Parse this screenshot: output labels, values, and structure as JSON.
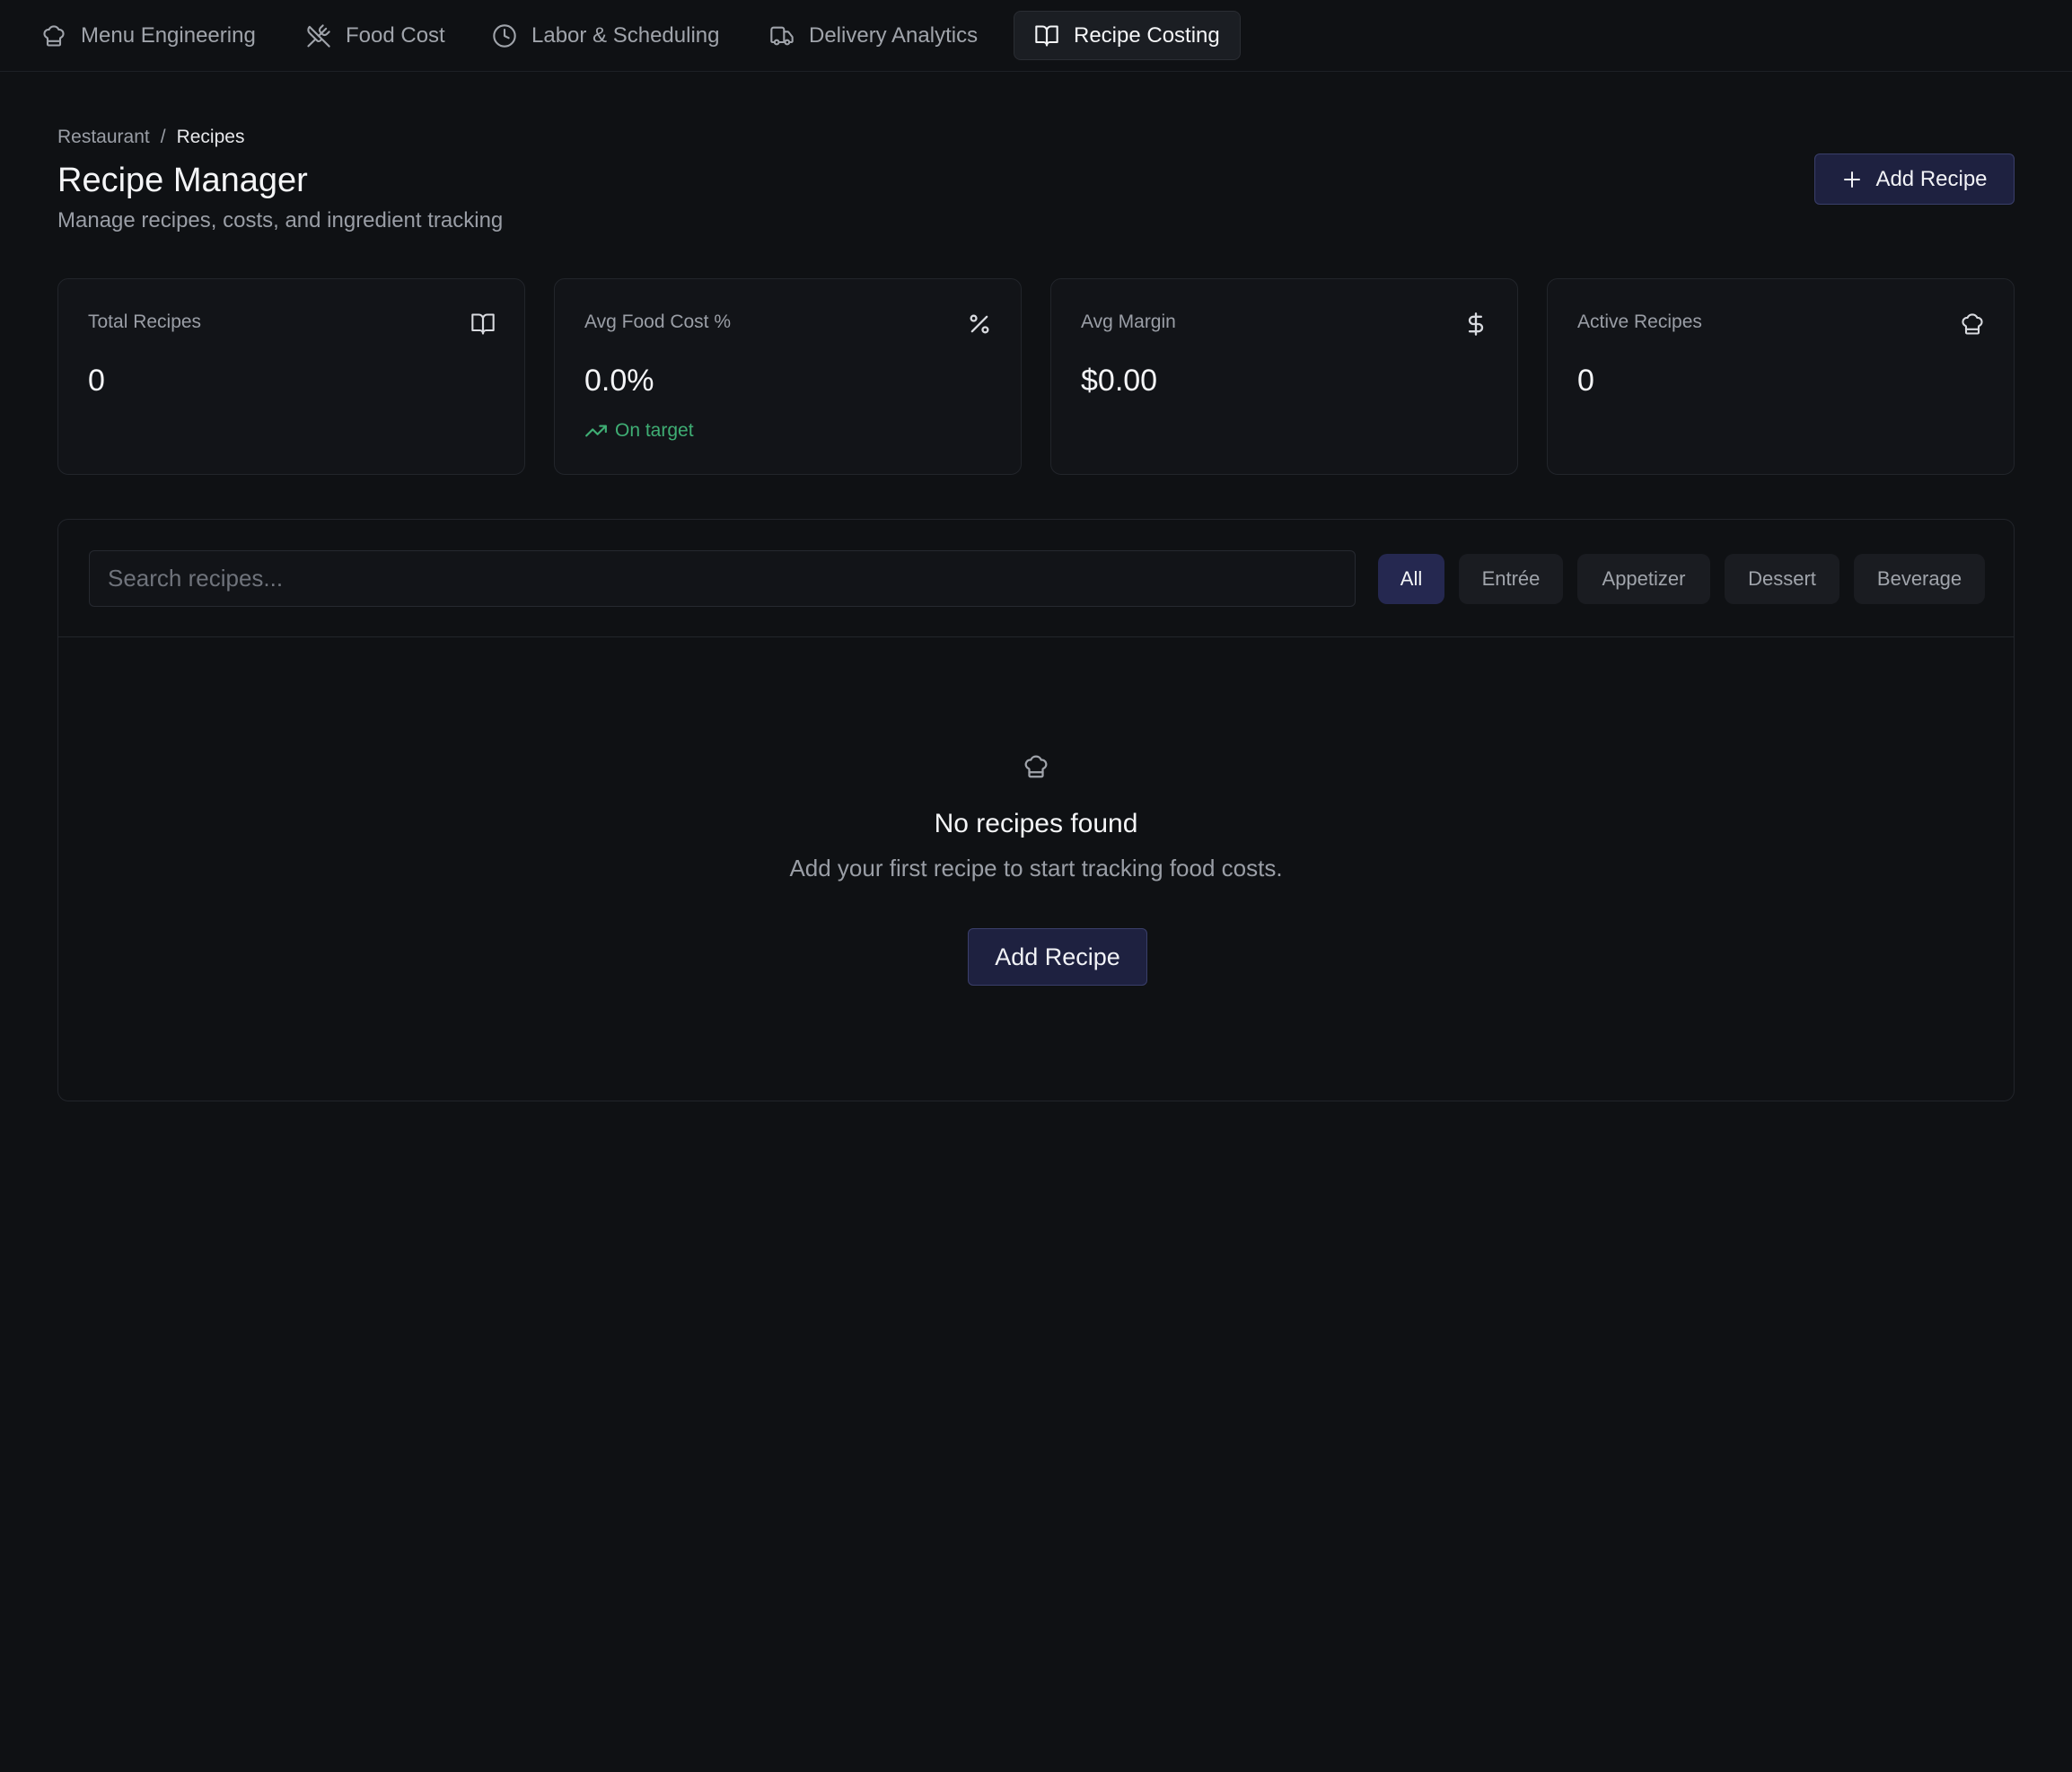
{
  "nav": {
    "tabs": [
      {
        "label": "Menu Engineering",
        "icon": "chef-hat-icon"
      },
      {
        "label": "Food Cost",
        "icon": "utensils-crossed-icon"
      },
      {
        "label": "Labor & Scheduling",
        "icon": "clock-icon"
      },
      {
        "label": "Delivery Analytics",
        "icon": "truck-icon"
      },
      {
        "label": "Recipe Costing",
        "icon": "book-open-icon",
        "active": true
      }
    ]
  },
  "header": {
    "breadcrumb": {
      "root": "Restaurant",
      "separator": "/",
      "current": "Recipes"
    },
    "title": "Recipe Manager",
    "subtitle": "Manage recipes, costs, and ingredient tracking",
    "add_button_label": "Add Recipe"
  },
  "stats": [
    {
      "label": "Total Recipes",
      "value": "0",
      "icon": "book-open-icon"
    },
    {
      "label": "Avg Food Cost %",
      "value": "0.0%",
      "icon": "percent-icon",
      "trend": "On target"
    },
    {
      "label": "Avg Margin",
      "value": "$0.00",
      "icon": "dollar-sign-icon"
    },
    {
      "label": "Active Recipes",
      "value": "0",
      "icon": "chef-hat-icon"
    }
  ],
  "filters": {
    "search_placeholder": "Search recipes...",
    "search_value": "",
    "categories": [
      "All",
      "Entrée",
      "Appetizer",
      "Dessert",
      "Beverage"
    ],
    "selected": "All"
  },
  "empty_state": {
    "icon": "chef-hat-icon",
    "title": "No recipes found",
    "text": "Add your first recipe to start tracking food costs.",
    "button_label": "Add Recipe"
  },
  "colors": {
    "background": "#0f1114",
    "accent": "#1e2140",
    "success": "#3fae74"
  }
}
